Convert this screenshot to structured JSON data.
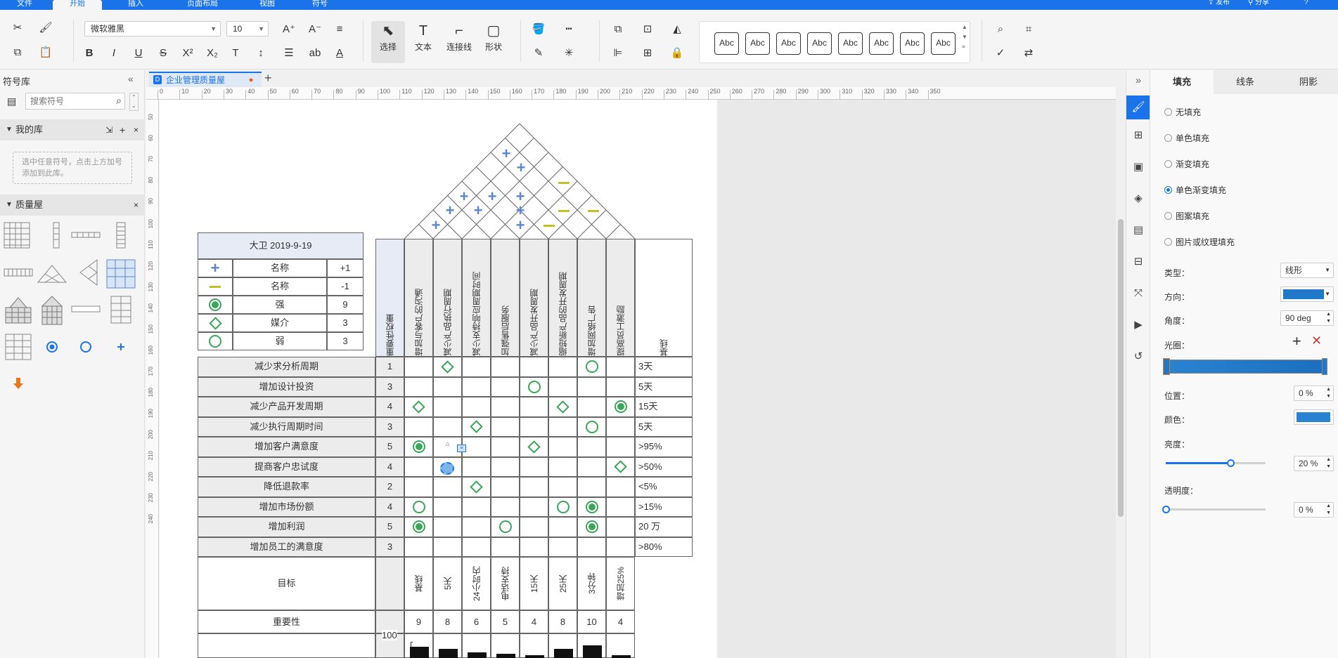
{
  "menu": {
    "tabs": [
      "文件",
      "开始",
      "插入",
      "页面布局",
      "视图",
      "符号"
    ],
    "active_tab": "开始",
    "publish": "发布",
    "share": "分享",
    "help": "?"
  },
  "ribbon": {
    "font_name": "微软雅黑",
    "font_size": "10",
    "tools": {
      "select": "选择",
      "text": "文本",
      "connector": "连接线",
      "shape": "形状"
    },
    "style_samples": [
      "Abc",
      "Abc",
      "Abc",
      "Abc",
      "Abc",
      "Abc",
      "Abc",
      "Abc"
    ],
    "style_colors": [
      "#e8a63b",
      "#8fa832",
      "#3e6db5",
      "#e0792c",
      "#4a86c7",
      "#4caf50",
      "#6b8fd4",
      "#b8a21a"
    ]
  },
  "left_panel": {
    "title": "符号库",
    "search_placeholder": "搜索符号",
    "my_library": "我的库",
    "my_library_hint": "选中任意符号，点击上方加号添加到此库。",
    "quality_house": "质量屋"
  },
  "document": {
    "tab_title": "企业管理质量屋",
    "ruler_h": [
      "0",
      "10",
      "20",
      "30",
      "40",
      "50",
      "60",
      "70",
      "80",
      "90",
      "100",
      "110",
      "120",
      "130",
      "140",
      "150",
      "160",
      "170",
      "180",
      "190",
      "200",
      "210",
      "220",
      "230",
      "240",
      "250",
      "260",
      "270",
      "280",
      "290",
      "300",
      "310",
      "320",
      "330",
      "340",
      "350"
    ],
    "ruler_v": [
      "50",
      "60",
      "70",
      "80",
      "90",
      "100",
      "110",
      "120",
      "130",
      "140",
      "150",
      "160",
      "170",
      "180",
      "190",
      "200",
      "210",
      "220",
      "230",
      "240"
    ]
  },
  "qfd": {
    "legend_title": "大卫 2019-9-19",
    "legend_rows": [
      {
        "symbol": "plus",
        "name": "名称",
        "value": "+1"
      },
      {
        "symbol": "minus",
        "name": "名称",
        "value": "-1"
      },
      {
        "symbol": "strong",
        "name": "强",
        "value": "9"
      },
      {
        "symbol": "diamond",
        "name": "媒介",
        "value": "3"
      },
      {
        "symbol": "circle",
        "name": "弱",
        "value": "3"
      }
    ],
    "weight_header": "重要性权重",
    "columns": [
      "增加与客户的沟通",
      "减少产品执行周期",
      "减少支持响应周期时间",
      "加强售后服务",
      "减少产品开发周期",
      "缩短新产品的开发周期",
      "增加网络广告",
      "提高员工激励"
    ],
    "baseline_header": "基线",
    "rows": [
      {
        "label": "减少求分析周期",
        "weight": "1",
        "baseline": "3天"
      },
      {
        "label": "增加设计投资",
        "weight": "3",
        "baseline": "5天"
      },
      {
        "label": "减少产品开发周期",
        "weight": "4",
        "baseline": "15天"
      },
      {
        "label": "减少执行周期时间",
        "weight": "3",
        "baseline": "5天"
      },
      {
        "label": "增加客户满意度",
        "weight": "5",
        "baseline": ">95%"
      },
      {
        "label": "提商客户忠试度",
        "weight": "4",
        "baseline": ">50%"
      },
      {
        "label": "降低退款率",
        "weight": "2",
        "baseline": "<5%"
      },
      {
        "label": "增加市场份额",
        "weight": "4",
        "baseline": ">15%"
      },
      {
        "label": "增加利润",
        "weight": "5",
        "baseline": "20 万"
      },
      {
        "label": "增加员工的满意度",
        "weight": "3",
        "baseline": ">80%"
      }
    ],
    "target_label": "目标",
    "targets": [
      "基线",
      "5天",
      "24小时内",
      "电话支持",
      "15天",
      "25天",
      "3分钟",
      "增加25%"
    ],
    "importance_label": "重要性",
    "importance": [
      "9",
      "8",
      "6",
      "5",
      "4",
      "8",
      "10",
      "4"
    ],
    "chart_max": "100"
  },
  "right_panel": {
    "tabs": [
      "填充",
      "线条",
      "阴影"
    ],
    "fill_options": [
      "无填充",
      "单色填充",
      "渐变填充",
      "单色渐变填充",
      "图案填充",
      "图片或纹理填充"
    ],
    "selected_fill": "单色渐变填充",
    "type_label": "类型：",
    "type_value": "线形",
    "direction_label": "方向：",
    "angle_label": "角度：",
    "angle_value": "90 deg",
    "aperture_label": "光圈：",
    "position_label": "位置：",
    "position_value": "0 %",
    "color_label": "颜色：",
    "brightness_label": "亮度：",
    "brightness_value": "20 %",
    "transparency_label": "透明度：",
    "transparency_value": "0 %",
    "brightness_level": 0.65,
    "transparency_level": 0.0
  },
  "colors": {
    "accent": "#1a73e8",
    "symbol_green": "#3ba65a",
    "plus_blue": "#5b86d1",
    "minus_yellow": "#c2c025",
    "gradient_blue": "#1f78c8"
  }
}
